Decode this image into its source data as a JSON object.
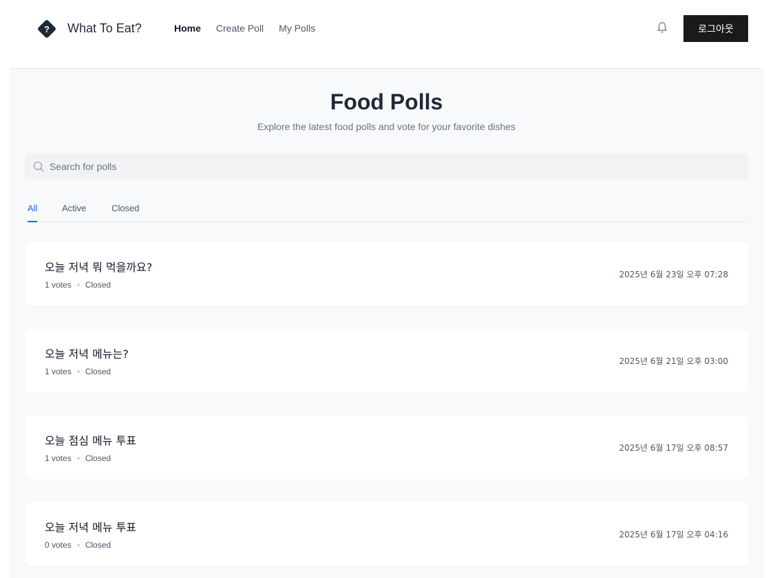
{
  "header": {
    "app_name": "What To Eat?",
    "nav": [
      {
        "label": "Home",
        "active": true
      },
      {
        "label": "Create Poll",
        "active": false
      },
      {
        "label": "My Polls",
        "active": false
      }
    ],
    "logout_label": "로그아웃"
  },
  "main": {
    "title": "Food Polls",
    "subtitle": "Explore the latest food polls and vote for your favorite dishes",
    "search": {
      "placeholder": "Search for polls",
      "value": ""
    },
    "tabs": [
      {
        "label": "All",
        "active": true
      },
      {
        "label": "Active",
        "active": false
      },
      {
        "label": "Closed",
        "active": false
      }
    ],
    "polls": [
      {
        "title": "오늘 저녁 뭐 먹을까요?",
        "votes": "1 votes",
        "status": "Closed",
        "date": "2025년 6월 23일 오후 07:28"
      },
      {
        "title": "오늘 저녁 메뉴는?",
        "votes": "1 votes",
        "status": "Closed",
        "date": "2025년 6월 21일 오후 03:00"
      },
      {
        "title": "오늘 점심 메뉴 투표",
        "votes": "1 votes",
        "status": "Closed",
        "date": "2025년 6월 17일 오후 08:57"
      },
      {
        "title": "오늘 저녁 메뉴 투표",
        "votes": "0 votes",
        "status": "Closed",
        "date": "2025년 6월 17일 오후 04:16"
      }
    ]
  },
  "colors": {
    "accent": "#2563eb",
    "button_bg": "#1a1a1a",
    "page_bg": "#f8f9fb"
  },
  "icons": {
    "logo": "question-diamond-icon",
    "bell": "bell-icon",
    "search": "search-icon"
  }
}
